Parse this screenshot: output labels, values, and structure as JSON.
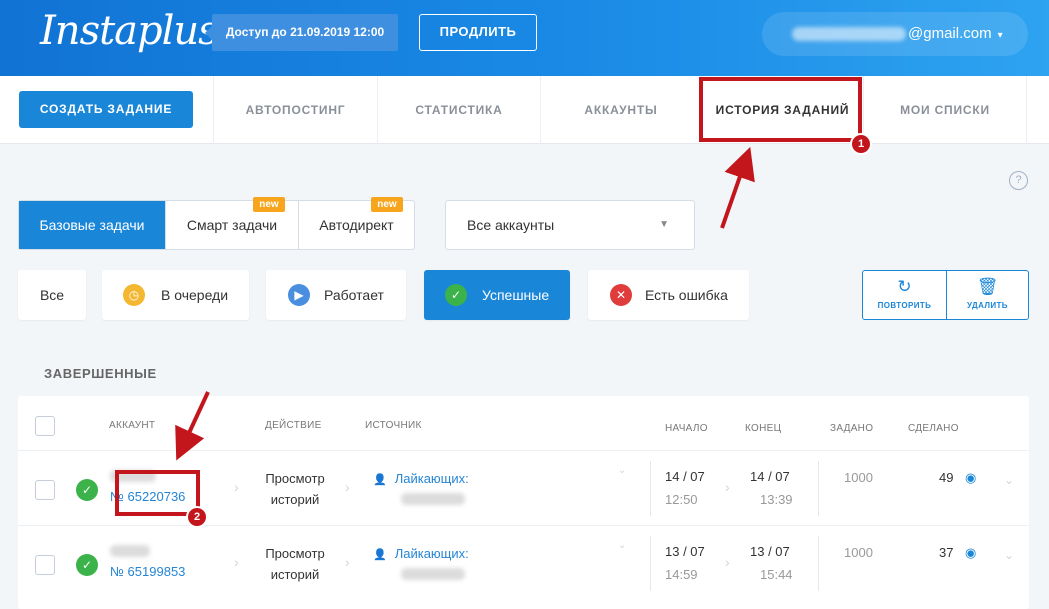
{
  "header": {
    "logo": "Instaplus",
    "access": "Доступ до 21.09.2019 12:00",
    "extend_label": "ПРОДЛИТЬ",
    "email_suffix": "@gmail.com"
  },
  "nav": {
    "create_label": "СОЗДАТЬ ЗАДАНИЕ",
    "items": [
      "АВТОПОСТИНГ",
      "СТАТИСТИКА",
      "АККАУНТЫ",
      "ИСТОРИЯ ЗАДАНИЙ",
      "МОИ СПИСКИ"
    ]
  },
  "tabs": {
    "items": [
      "Базовые задачи",
      "Смарт задачи",
      "Автодирект"
    ],
    "badge": "new"
  },
  "account_select": {
    "value": "Все аккаунты"
  },
  "filters": [
    "Все",
    "В очереди",
    "Работает",
    "Успешные",
    "Есть ошибка"
  ],
  "actions": {
    "repeat": "ПОВТОРИТЬ",
    "delete": "УДАЛИТЬ"
  },
  "section_title": "ЗАВЕРШЕННЫЕ",
  "table": {
    "columns": {
      "account": "АККАУНТ",
      "action": "ДЕЙСТВИЕ",
      "source": "ИСТОЧНИК",
      "start": "НАЧАЛО",
      "end": "КОНЕЦ",
      "set": "ЗАДАНО",
      "done": "СДЕЛАНО"
    },
    "rows": [
      {
        "number": "№ 65220736",
        "action_line1": "Просмотр",
        "action_line2": "историй",
        "source": "Лайкающих:",
        "start_date": "14 / 07",
        "start_time": "12:50",
        "end_date": "14 / 07",
        "end_time": "13:39",
        "set": "1000",
        "done": "49"
      },
      {
        "number": "№ 65199853",
        "action_line1": "Просмотр",
        "action_line2": "историй",
        "source": "Лайкающих:",
        "start_date": "13 / 07",
        "start_time": "14:59",
        "end_date": "13 / 07",
        "end_time": "15:44",
        "set": "1000",
        "done": "37"
      }
    ]
  },
  "annotations": {
    "marker1": "1",
    "marker2": "2"
  },
  "colors": {
    "accent": "#1a86d8",
    "annotation": "#c3161c",
    "success": "#3cb34a"
  }
}
